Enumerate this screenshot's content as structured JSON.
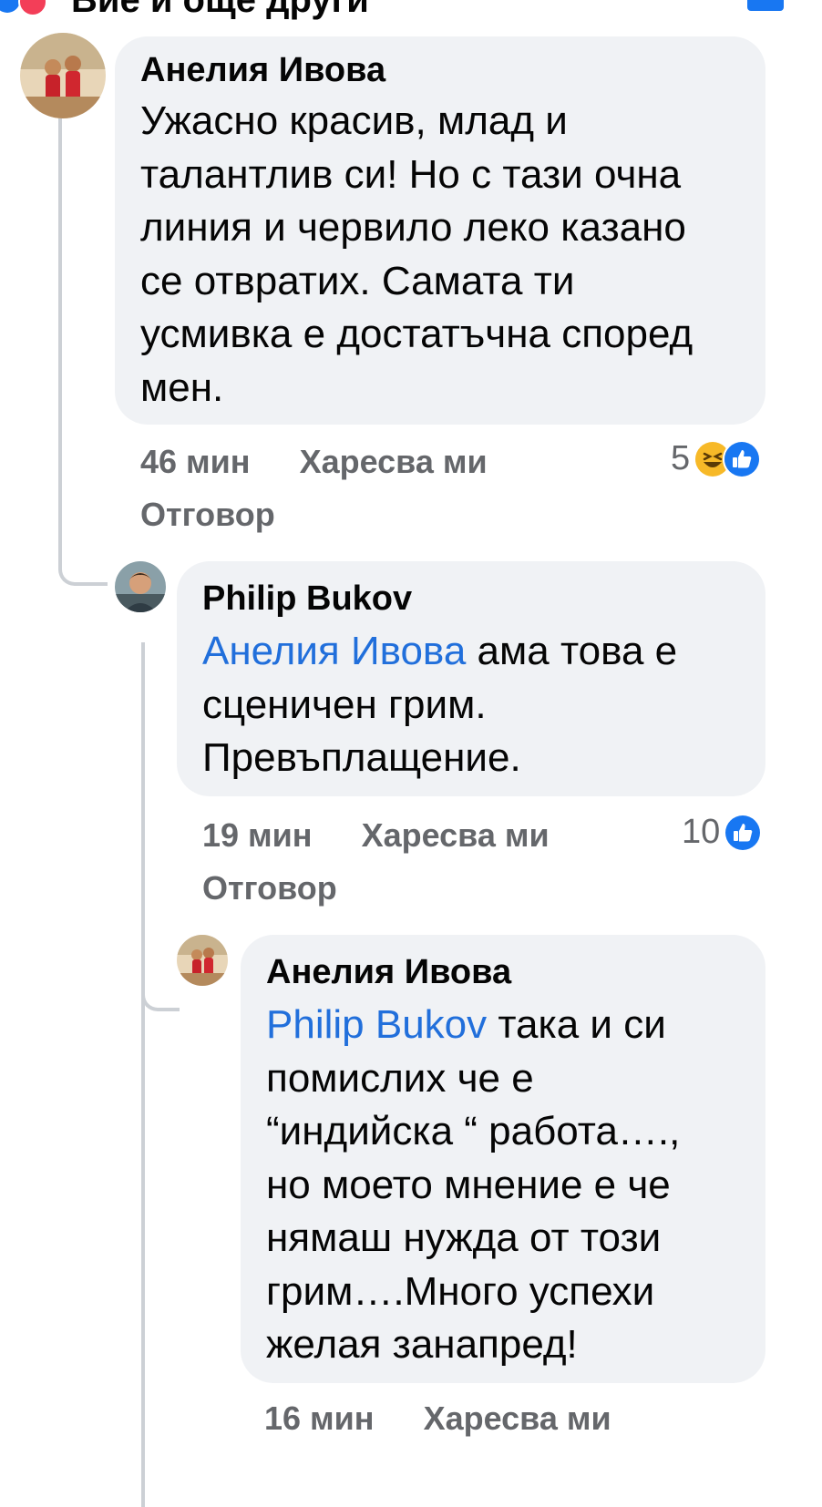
{
  "header": {
    "partial_text": "Вие и още други",
    "icon_left": "reaction-icons-like-love",
    "icon_right": "share-icon"
  },
  "comments": [
    {
      "author": "Анелия Ивова",
      "lines": [
        "Ужасно красив, млад и",
        "талантлив си! Но с тази очна",
        "линия и червило леко казано",
        "се отвратих. Самата ти",
        "усмивка е достатъчна според",
        "мен."
      ],
      "time": "46 мин",
      "like": "Харесва ми",
      "reply": "Отговор",
      "reaction_count": "5",
      "reactions": [
        "haha",
        "like"
      ]
    },
    {
      "author": "Philip Bukov",
      "mention": "Анелия Ивова",
      "lines": [
        " ама това е",
        "сценичен грим.",
        "Превъплащение."
      ],
      "time": "19 мин",
      "like": "Харесва ми",
      "reply": "Отговор",
      "reaction_count": "10",
      "reactions": [
        "like"
      ]
    },
    {
      "author": "Анелия Ивова",
      "mention": "Philip Bukov",
      "lines": [
        " така и си",
        "помислих че е",
        "“индийска “ работа….,",
        "но моето мнение е че",
        "нямаш нужда от този",
        "грим….Много успехи",
        "желая занапред!"
      ],
      "time": "16 мин",
      "like": "Харесва ми"
    }
  ],
  "colors": {
    "bubble": "#f0f2f5",
    "meta": "#65676b",
    "mention": "#216fdb",
    "like_blue": "#1877f2",
    "haha_yellow": "#f7b928",
    "thread_line": "#ccd0d5"
  }
}
